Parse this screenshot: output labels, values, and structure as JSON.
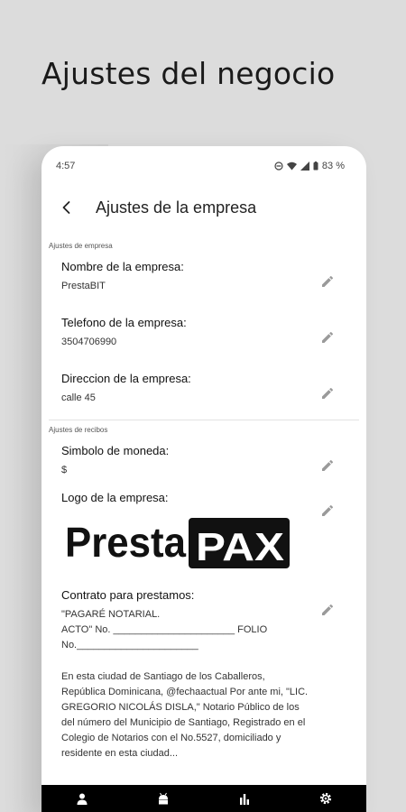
{
  "promo": {
    "title": "Ajustes del negocio"
  },
  "status_bar": {
    "time": "4:57",
    "battery": "83 %"
  },
  "app_bar": {
    "title": "Ajustes de la empresa"
  },
  "sections": {
    "company": "Ajustes de empresa",
    "receipts": "Ajustes de recibos"
  },
  "company": {
    "name_label": "Nombre de la empresa:",
    "name_value": "PrestaBIT",
    "phone_label": "Telefono de la empresa:",
    "phone_value": "3504706990",
    "address_label": "Direccion de la empresa:",
    "address_value": "calle 45"
  },
  "receipts": {
    "currency_label": "Simbolo de moneda:",
    "currency_value": "$",
    "logo_label": "Logo de la empresa:",
    "logo_text_left": "Presta",
    "logo_text_right": "PAX",
    "contract_label": "Contrato para prestamos:",
    "contract_header": "\"PAGARÉ NOTARIAL.\nACTO\" No. ______________________       FOLIO\nNo.______________________",
    "contract_body": "En esta ciudad de Santiago de los Caballeros, República Dominicana, @fechaactual Por ante mi, \"LIC. GREGORIO NICOLÁS DISLA,\" Notario Público de los del número del Municipio de Santiago, Registrado en el Colegio de Notarios con el No.5527, domiciliado y residente en esta ciudad..."
  },
  "nav": [
    "person-icon",
    "android-icon",
    "bar-chart-icon",
    "settings-icon"
  ]
}
